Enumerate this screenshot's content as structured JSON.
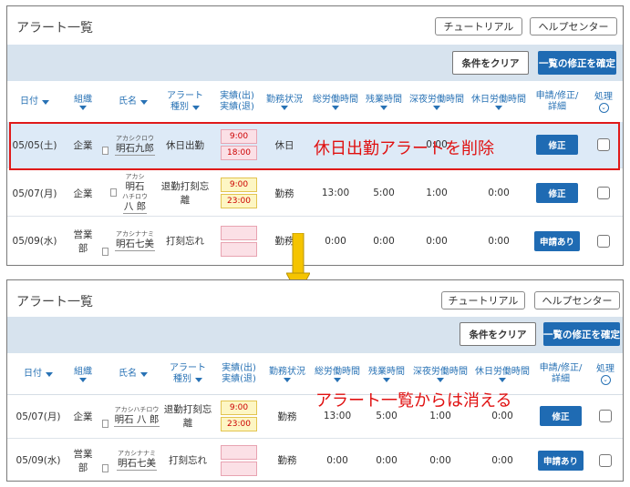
{
  "screens": [
    {
      "title": "アラート一覧",
      "tutorial_label": "チュートリアル",
      "help_label": "ヘルプセンター",
      "clear_label": "条件をクリア",
      "bulk_label": "一覧の修正を確定",
      "headers": {
        "date": "日付",
        "org": "組織",
        "name": "氏名",
        "alert_1": "アラート",
        "alert_2": "種別",
        "time_1": "実績(出)",
        "time_2": "実績(退)",
        "status": "勤務状況",
        "total": "総労働時間",
        "overtime": "残業時間",
        "night": "深夜労働時間",
        "holiday": "休日労働時間",
        "apply_1": "申請/修正/",
        "apply_2": "詳細",
        "process": "処理",
        "process_icon": "⌄"
      },
      "rows": [
        {
          "date": "05/05(土)",
          "org": "企業",
          "kana": "アカシクロウ",
          "name": "明石九郎",
          "alert": "休日出勤",
          "in": "9:00",
          "out": "18:00",
          "status": "休日",
          "total": "",
          "overtime": "",
          "night": "0:00",
          "holiday": "",
          "button": "修正"
        },
        {
          "date": "05/07(月)",
          "org": "企業",
          "kana": "アカシ",
          "kana2": "ハチロウ",
          "name": "明石",
          "name2": "八 郎",
          "alert": "退勤打刻忘",
          "alert2": "離",
          "in": "9:00",
          "out": "23:00",
          "status": "勤務",
          "total": "13:00",
          "overtime": "5:00",
          "night": "1:00",
          "holiday": "0:00",
          "button": "修正"
        },
        {
          "date": "05/09(水)",
          "org": "営業",
          "org2": "部",
          "kana": "アカシナナミ",
          "name": "明石七美",
          "alert": "打刻忘れ",
          "in": "",
          "out": "",
          "status": "勤務",
          "total": "0:00",
          "overtime": "0:00",
          "night": "0:00",
          "holiday": "0:00",
          "button": "申請あり"
        }
      ],
      "overlay": "休日出勤アラートを削除"
    },
    {
      "title": "アラート一覧",
      "tutorial_label": "チュートリアル",
      "help_label": "ヘルプセンター",
      "clear_label": "条件をクリア",
      "bulk_label": "一覧の修正を確定",
      "headers": {
        "date": "日付",
        "org": "組織",
        "name": "氏名",
        "alert_1": "アラート",
        "alert_2": "種別",
        "time_1": "実績(出)",
        "time_2": "実績(退)",
        "status": "勤務状況",
        "total": "総労働時間",
        "overtime": "残業時間",
        "night": "深夜労働時間",
        "holiday": "休日労働時間",
        "apply_1": "申請/修正/",
        "apply_2": "詳細",
        "process": "処理",
        "process_icon": "⌄"
      },
      "rows": [
        {
          "date": "05/07(月)",
          "org": "企業",
          "kana": "アカシハチロウ",
          "name": "明石 八 郎",
          "alert": "退勤打刻忘",
          "alert2": "離",
          "in": "9:00",
          "out": "23:00",
          "status": "勤務",
          "total": "13:00",
          "overtime": "5:00",
          "night": "1:00",
          "holiday": "0:00",
          "button": "修正"
        },
        {
          "date": "05/09(水)",
          "org": "営業",
          "org2": "部",
          "kana": "アカシナナミ",
          "name": "明石七美",
          "alert": "打刻忘れ",
          "in": "",
          "out": "",
          "status": "勤務",
          "total": "0:00",
          "overtime": "0:00",
          "night": "0:00",
          "holiday": "0:00",
          "button": "申請あり"
        }
      ],
      "overlay": "アラート一覧からは消える"
    }
  ],
  "colors": {
    "accent": "#1f6bb3",
    "highlight": "#e01a1a",
    "arrow": "#f5c400"
  },
  "arrow_icon": "arrow-down-icon"
}
